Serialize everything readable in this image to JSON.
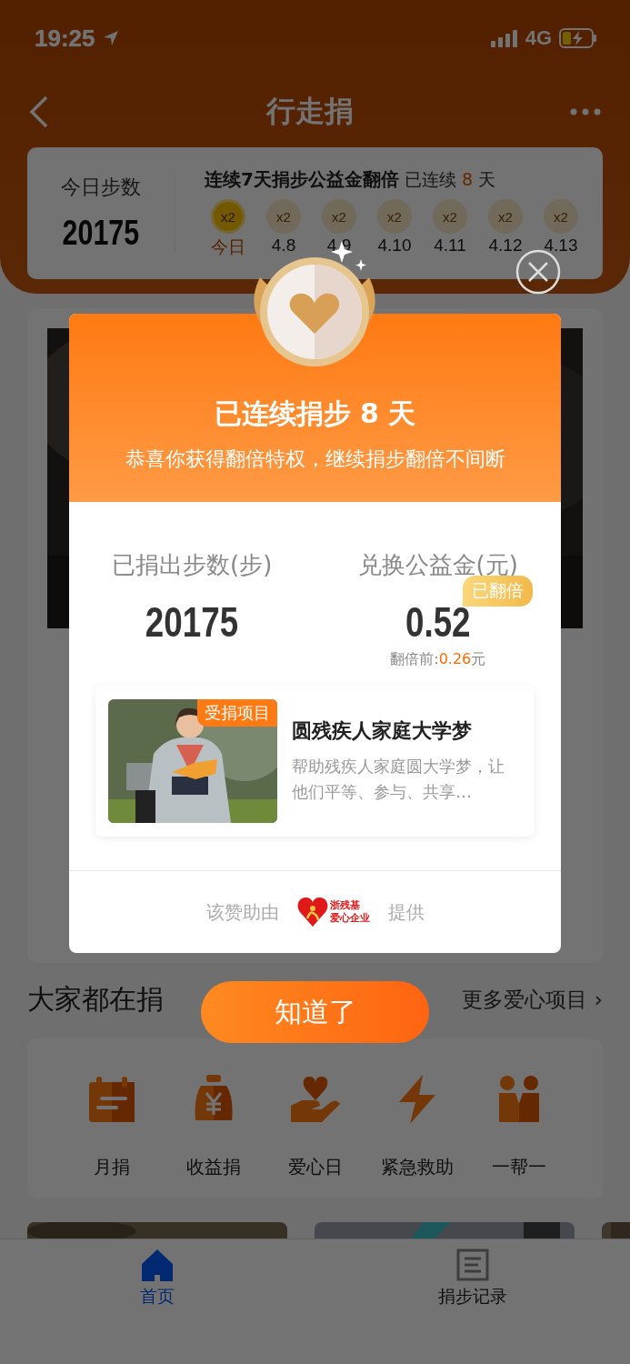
{
  "status_bar": {
    "time": "19:25",
    "network": "4G"
  },
  "header": {
    "title": "行走捐"
  },
  "steps_card": {
    "label": "今日步数",
    "value": "20175",
    "streak_title": "连续7天捐步公益金翻倍",
    "streak_prefix": "已连续",
    "streak_days": "8",
    "streak_suffix": "天",
    "days": [
      {
        "badge": "x2",
        "label": "今日",
        "selected": true
      },
      {
        "badge": "x2",
        "label": "4.8",
        "selected": false
      },
      {
        "badge": "x2",
        "label": "4.9",
        "selected": false
      },
      {
        "badge": "x2",
        "label": "4.10",
        "selected": false
      },
      {
        "badge": "x2",
        "label": "4.11",
        "selected": false
      },
      {
        "badge": "x2",
        "label": "4.12",
        "selected": false
      },
      {
        "badge": "x2",
        "label": "4.13",
        "selected": false
      }
    ]
  },
  "section": {
    "title": "大家都在捐",
    "more": "更多爱心项目",
    "more_arrow": "›"
  },
  "categories": [
    {
      "kind": "calendar",
      "label": "月捐"
    },
    {
      "kind": "moneybag",
      "label": "收益捐"
    },
    {
      "kind": "hearthand",
      "label": "爱心日"
    },
    {
      "kind": "lightning",
      "label": "紧急救助"
    },
    {
      "kind": "people",
      "label": "一帮一"
    }
  ],
  "tab_bar": [
    {
      "kind": "home",
      "label": "首页",
      "selected": true
    },
    {
      "kind": "list",
      "label": "捐步记录",
      "selected": false
    }
  ],
  "modal": {
    "title": "已连续捐步 8 天",
    "subtitle": "恭喜你获得翻倍特权，继续捐步翻倍不间断",
    "stats": [
      {
        "label": "已捐出步数(步)",
        "value": "20175"
      },
      {
        "label": "兑换公益金(元)",
        "value": "0.52",
        "badge": "已翻倍",
        "note_label": "翻倍前:",
        "note_amount": "0.26",
        "note_unit": "元"
      }
    ],
    "project": {
      "tag": "受捐项目",
      "title": "圆残疾人家庭大学梦",
      "description": "帮助残疾人家庭圆大学梦，让他们平等、参与、共享…"
    },
    "sponsor": {
      "prefix": "该赞助由",
      "logo_lines": [
        "浙残基",
        "爱心企业"
      ],
      "suffix": "提供"
    },
    "button": "知道了"
  }
}
